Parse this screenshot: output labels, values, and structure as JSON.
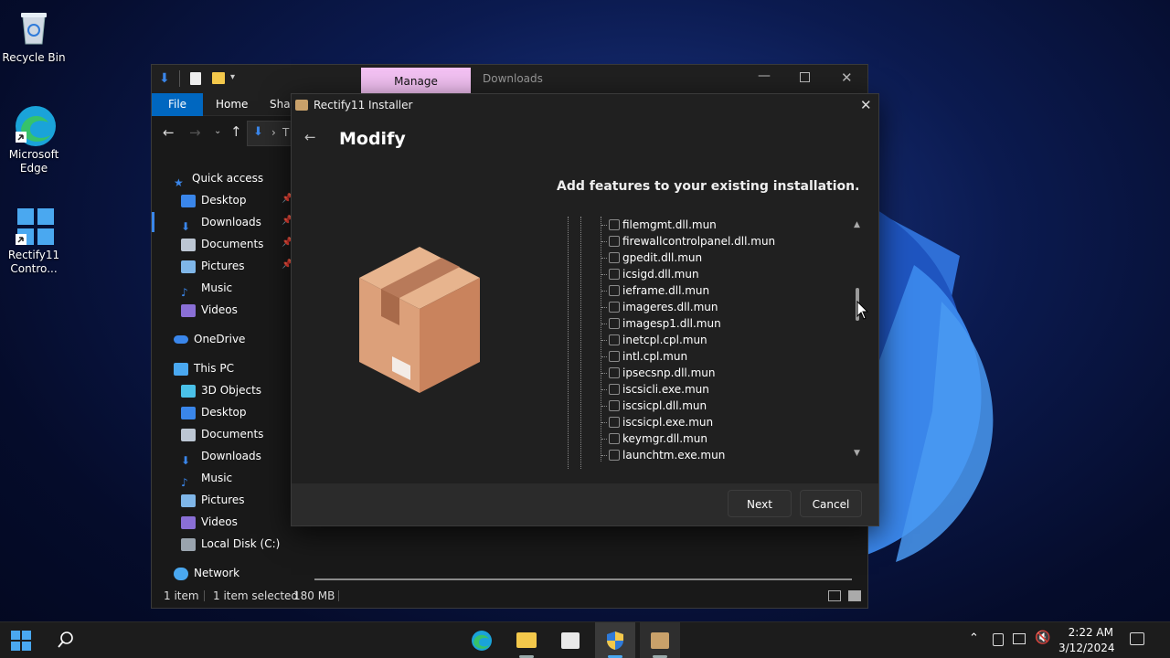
{
  "desktop": {
    "icons": [
      {
        "label": "Recycle Bin"
      },
      {
        "label": "Microsoft Edge"
      },
      {
        "label": "Rectify11 Contro..."
      }
    ]
  },
  "explorer": {
    "title_tab_manage": "Manage",
    "title_tab_downloads": "Downloads",
    "ribbon": {
      "file": "File",
      "home": "Home",
      "share": "Shar"
    },
    "address_fragment": "T",
    "nav": {
      "quick_access": "Quick access",
      "qa_items": [
        "Desktop",
        "Downloads",
        "Documents",
        "Pictures",
        "Music",
        "Videos"
      ],
      "onedrive": "OneDrive",
      "this_pc": "This PC",
      "pc_items": [
        "3D Objects",
        "Desktop",
        "Documents",
        "Downloads",
        "Music",
        "Pictures",
        "Videos",
        "Local Disk (C:)"
      ],
      "network": "Network"
    },
    "status": {
      "count": "1 item",
      "selected": "1 item selected",
      "size": "180 MB"
    }
  },
  "installer": {
    "title": "Rectify11 Installer",
    "heading": "Modify",
    "subheading": "Add features to your existing installation.",
    "files": [
      "filemgmt.dll.mun",
      "firewallcontrolpanel.dll.mun",
      "gpedit.dll.mun",
      "icsigd.dll.mun",
      "ieframe.dll.mun",
      "imageres.dll.mun",
      "imagesp1.dll.mun",
      "inetcpl.cpl.mun",
      "intl.cpl.mun",
      "ipsecsnp.dll.mun",
      "iscsicli.exe.mun",
      "iscsicpl.dll.mun",
      "iscsicpl.exe.mun",
      "keymgr.dll.mun",
      "launchtm.exe.mun"
    ],
    "next_label": "Next",
    "cancel_label": "Cancel"
  },
  "taskbar": {
    "time": "2:22 AM",
    "date": "3/12/2024"
  },
  "colors": {
    "accent": "#0078d4",
    "manage_tab": "#f4c2f4",
    "file_tab": "#0067c0"
  }
}
